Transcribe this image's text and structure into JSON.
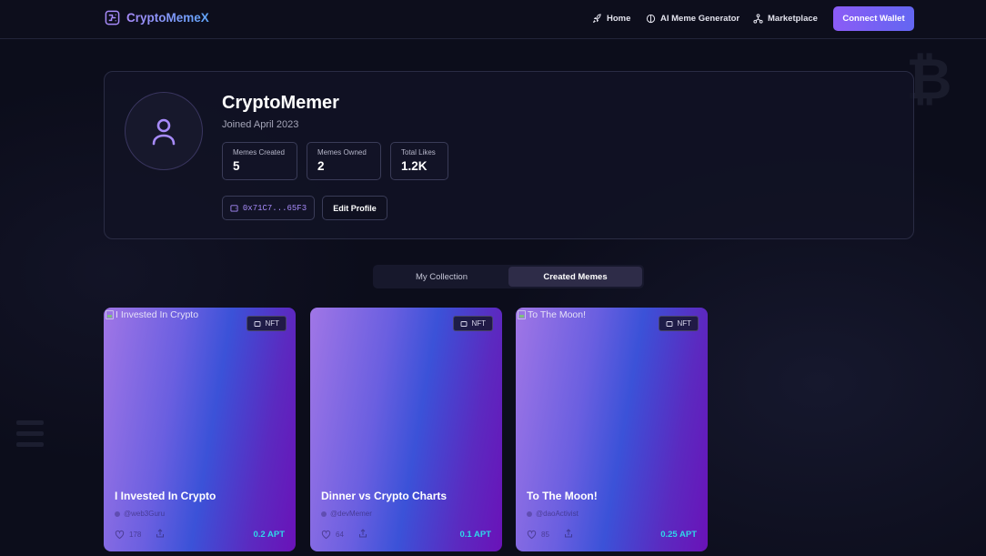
{
  "nav": {
    "brand": "CryptoMemeX",
    "links": [
      {
        "label": "Home",
        "icon": "rocket-icon"
      },
      {
        "label": "AI Meme Generator",
        "icon": "brain-icon"
      },
      {
        "label": "Marketplace",
        "icon": "network-icon"
      }
    ],
    "connect_label": "Connect Wallet"
  },
  "profile": {
    "username": "CryptoMemer",
    "joined": "Joined April 2023",
    "stats": [
      {
        "label": "Memes Created",
        "value": "5"
      },
      {
        "label": "Memes Owned",
        "value": "2"
      },
      {
        "label": "Total Likes",
        "value": "1.2K"
      }
    ],
    "wallet": "0x71C7...65F3",
    "edit_label": "Edit Profile"
  },
  "tabs": [
    {
      "label": "My Collection",
      "active": false
    },
    {
      "label": "Created Memes",
      "active": true
    }
  ],
  "memes": [
    {
      "image_alt": "I Invested In Crypto",
      "badge": "NFT",
      "title": "I Invested In Crypto",
      "creator": "@web3Guru",
      "likes": "178",
      "price": "0.2 APT"
    },
    {
      "image_alt": "",
      "badge": "NFT",
      "title": "Dinner vs Crypto Charts",
      "creator": "@devMemer",
      "likes": "64",
      "price": "0.1 APT"
    },
    {
      "image_alt": "To The Moon!",
      "badge": "NFT",
      "title": "To The Moon!",
      "creator": "@daoActivist",
      "likes": "85",
      "price": "0.25 APT"
    }
  ],
  "colors": {
    "accent": "#8b5cf6",
    "price": "#2fd8e8",
    "background": "#0c0d1b"
  }
}
